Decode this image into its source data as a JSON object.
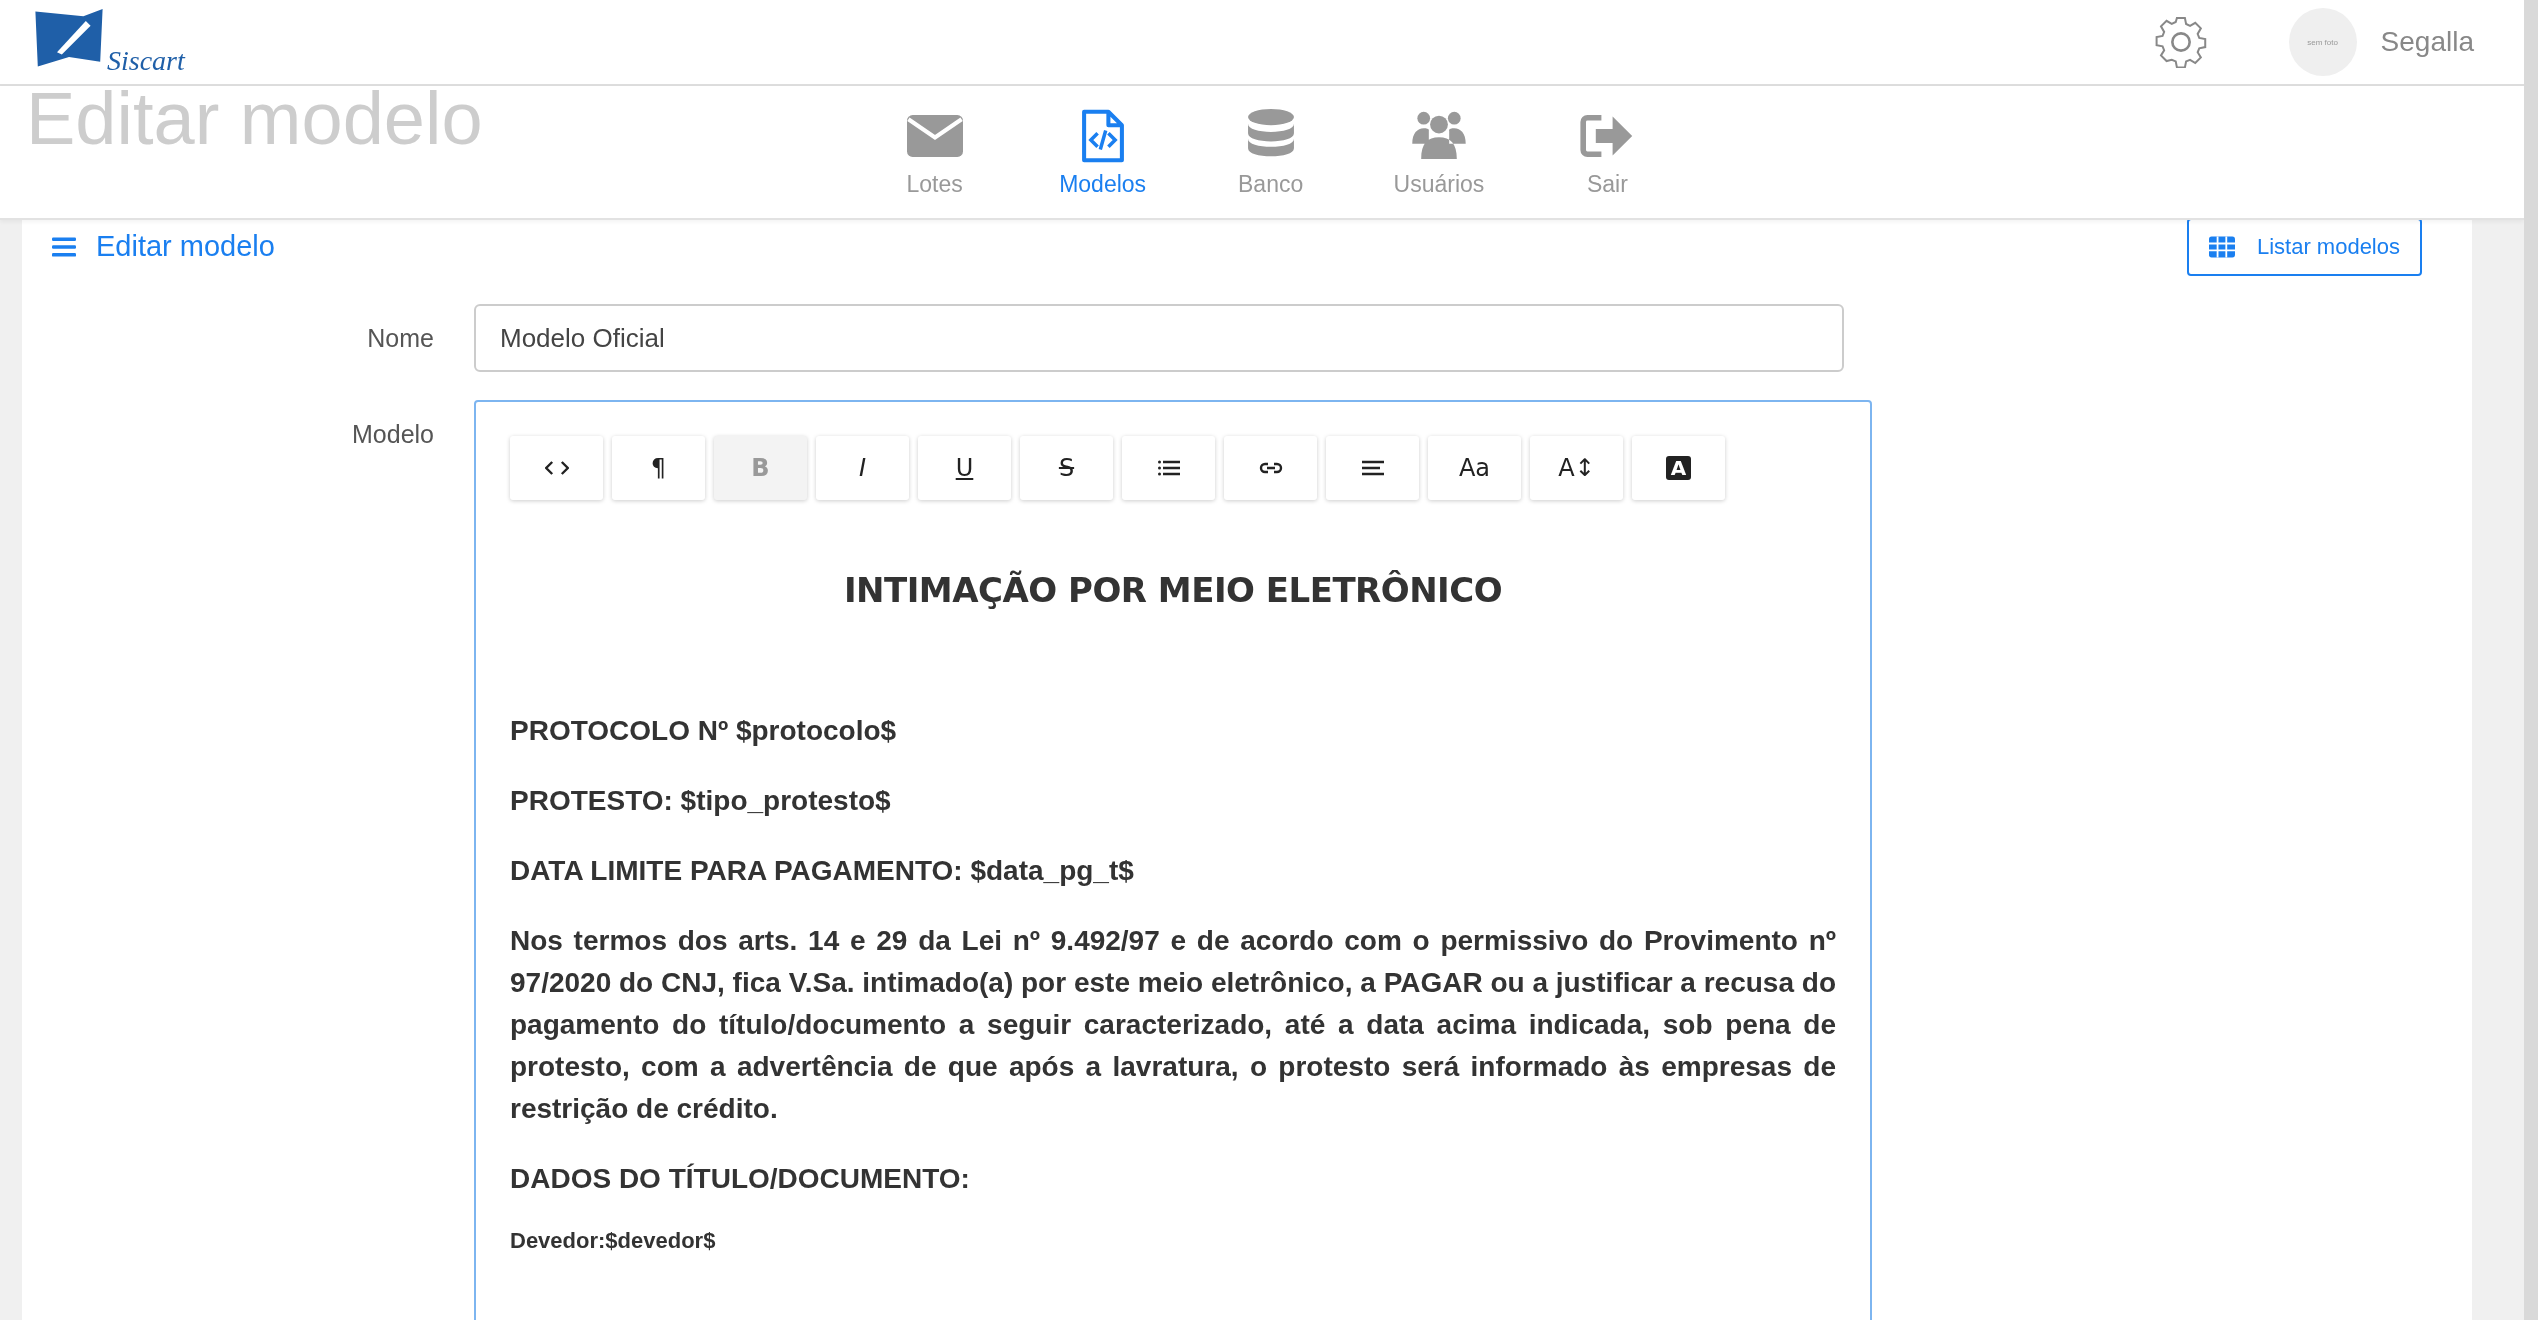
{
  "header": {
    "logo": "Siscart",
    "user": {
      "avatar_text": "sem foto",
      "name": "Segalla"
    }
  },
  "nav": [
    {
      "kind": "lotes",
      "label": "Lotes",
      "selected": false
    },
    {
      "kind": "modelos",
      "label": "Modelos",
      "selected": true
    },
    {
      "kind": "banco",
      "label": "Banco",
      "selected": false
    },
    {
      "kind": "usuarios",
      "label": "Usuários",
      "selected": false
    },
    {
      "kind": "sair",
      "label": "Sair",
      "selected": false
    }
  ],
  "page": {
    "ghost_title": "Editar modelo",
    "heading": "Editar modelo",
    "list_button": "Listar modelos"
  },
  "form": {
    "name": {
      "label": "Nome",
      "value": "Modelo Oficial"
    },
    "model": {
      "label": "Modelo",
      "toolbar": [
        {
          "kind": "code",
          "active": false
        },
        {
          "kind": "text",
          "label": "¶",
          "active": false
        },
        {
          "kind": "text",
          "label": "B",
          "active": true
        },
        {
          "kind": "italic",
          "label": "I",
          "active": false
        },
        {
          "kind": "underline",
          "label": "U",
          "active": false
        },
        {
          "kind": "strike",
          "label": "S",
          "active": false
        },
        {
          "kind": "list",
          "active": false
        },
        {
          "kind": "link",
          "active": false
        },
        {
          "kind": "align",
          "active": false
        },
        {
          "kind": "text",
          "label": "Aa",
          "active": false
        },
        {
          "kind": "text",
          "label": "A↕",
          "active": false
        },
        {
          "kind": "inverse",
          "label": "A",
          "active": false
        }
      ],
      "content": [
        {
          "kind": "title",
          "text": "INTIMAÇÃO POR MEIO ELETRÔNICO"
        },
        {
          "kind": "paragraph",
          "text": "PROTOCOLO Nº $protocolo$"
        },
        {
          "kind": "paragraph",
          "text": "PROTESTO: $tipo_protesto$"
        },
        {
          "kind": "paragraph",
          "text": "DATA LIMITE PARA PAGAMENTO: $data_pg_t$"
        },
        {
          "kind": "paragraph",
          "text": "Nos termos dos arts. 14 e 29 da Lei nº 9.492/97 e de acordo com o permissivo do Provimento nº 97/2020 do CNJ, fica V.Sa. intimado(a) por este meio eletrônico, a PAGAR ou a justificar a recusa do pagamento do título/documento a seguir caracterizado, até a data acima indicada, sob pena de protesto, com a advertência de que após a lavratura, o protesto será informado às empresas de restrição de crédito."
        },
        {
          "kind": "paragraph",
          "text": "DADOS DO TÍTULO/DOCUMENTO:"
        },
        {
          "kind": "small",
          "text": "Devedor:$devedor$"
        }
      ]
    }
  }
}
